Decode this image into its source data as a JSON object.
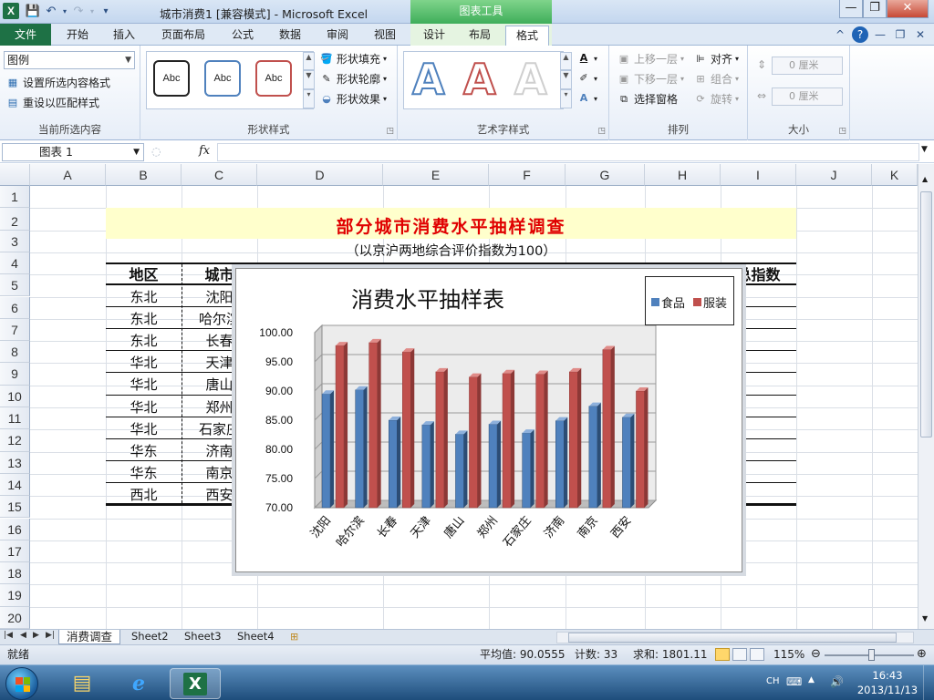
{
  "window": {
    "app_icon": "X",
    "title": "城市消费1  [兼容模式]  -  Microsoft Excel",
    "context_header": "图表工具",
    "qat": {
      "save": "💾",
      "undo": "↶",
      "redo": "↷",
      "customize": "▾"
    },
    "controls": {
      "minimize": "—",
      "restore": "❐",
      "close": "✕"
    }
  },
  "tabs": [
    {
      "label": "文件"
    },
    {
      "label": "开始"
    },
    {
      "label": "插入"
    },
    {
      "label": "页面布局"
    },
    {
      "label": "公式"
    },
    {
      "label": "数据"
    },
    {
      "label": "审阅"
    },
    {
      "label": "视图"
    },
    {
      "label": "设计"
    },
    {
      "label": "布局"
    },
    {
      "label": "格式"
    }
  ],
  "tab_icons": {
    "collapse": "^",
    "help": "?",
    "min": "—",
    "restore": "❐",
    "close": "✕"
  },
  "ribbon": {
    "current_selection": {
      "dropdown_value": "图例",
      "format_selection": "设置所选内容格式",
      "reset_style": "重设以匹配样式",
      "label": "当前所选内容"
    },
    "shape_styles": {
      "swatch_text": "Abc",
      "fill": "形状填充",
      "outline": "形状轮廓",
      "effects": "形状效果",
      "label": "形状样式"
    },
    "wordart": {
      "letter": "A",
      "label": "艺术字样式"
    },
    "arrange": {
      "bring_forward": "上移一层",
      "send_backward": "下移一层",
      "selection_pane": "选择窗格",
      "align": "对齐",
      "group": "组合",
      "rotate": "旋转",
      "label": "排列"
    },
    "size": {
      "height": "0 厘米",
      "width": "0 厘米",
      "label": "大小"
    }
  },
  "formula_bar": {
    "name_box": "图表 1",
    "fx": "fx",
    "value": ""
  },
  "columns": [
    "A",
    "B",
    "C",
    "D",
    "E",
    "F",
    "G",
    "H",
    "I",
    "J",
    "K"
  ],
  "rows": [
    "1",
    "2",
    "3",
    "4",
    "5",
    "6",
    "7",
    "8",
    "9",
    "10",
    "11",
    "12",
    "13",
    "14",
    "15",
    "16",
    "17",
    "18",
    "19",
    "20"
  ],
  "sheet": {
    "title": "部分城市消费水平抽样调查",
    "subtitle": "（以京沪两地综合评价指数为100）",
    "header_region": "地区",
    "header_city": "城市",
    "header_index": "总指数",
    "table": [
      {
        "region": "东北",
        "city": "沈阳"
      },
      {
        "region": "东北",
        "city": "哈尔滨"
      },
      {
        "region": "东北",
        "city": "长春"
      },
      {
        "region": "华北",
        "city": "天津"
      },
      {
        "region": "华北",
        "city": "唐山"
      },
      {
        "region": "华北",
        "city": "郑州"
      },
      {
        "region": "华北",
        "city": "石家庄"
      },
      {
        "region": "华东",
        "city": "济南"
      },
      {
        "region": "华东",
        "city": "南京"
      },
      {
        "region": "西北",
        "city": "西安"
      }
    ]
  },
  "chart_data": {
    "type": "bar",
    "title": "消费水平抽样表",
    "categories": [
      "沈阳",
      "哈尔滨",
      "长春",
      "天津",
      "唐山",
      "郑州",
      "石家庄",
      "济南",
      "南京",
      "西安"
    ],
    "series": [
      {
        "name": "食品",
        "color": "#4f81bd",
        "values": [
          89.5,
          90.2,
          85.0,
          84.2,
          82.6,
          84.3,
          82.8,
          84.9,
          87.4,
          85.5
        ]
      },
      {
        "name": "服装",
        "color": "#c0504d",
        "values": [
          97.8,
          98.3,
          96.7,
          93.3,
          92.4,
          93.0,
          92.9,
          93.3,
          97.1,
          90.0
        ]
      }
    ],
    "ylim": [
      70,
      100
    ],
    "yticks": [
      "70.00",
      "75.00",
      "80.00",
      "85.00",
      "90.00",
      "95.00",
      "100.00"
    ],
    "grid": true,
    "legend": "top-right",
    "style": "3d-clustered-column"
  },
  "sheet_tabs": {
    "active": "消费调查",
    "others": [
      "Sheet2",
      "Sheet3",
      "Sheet4"
    ],
    "nav": "◀◀ ◀ ▶ ▶▶"
  },
  "status": {
    "ready": "就绪",
    "average": "平均值: 90.0555",
    "count": "计数: 33",
    "sum": "求和: 1801.11",
    "zoom": "115%"
  },
  "taskbar": {
    "language": "CH",
    "time": "16:43",
    "date": "2013/11/13"
  }
}
